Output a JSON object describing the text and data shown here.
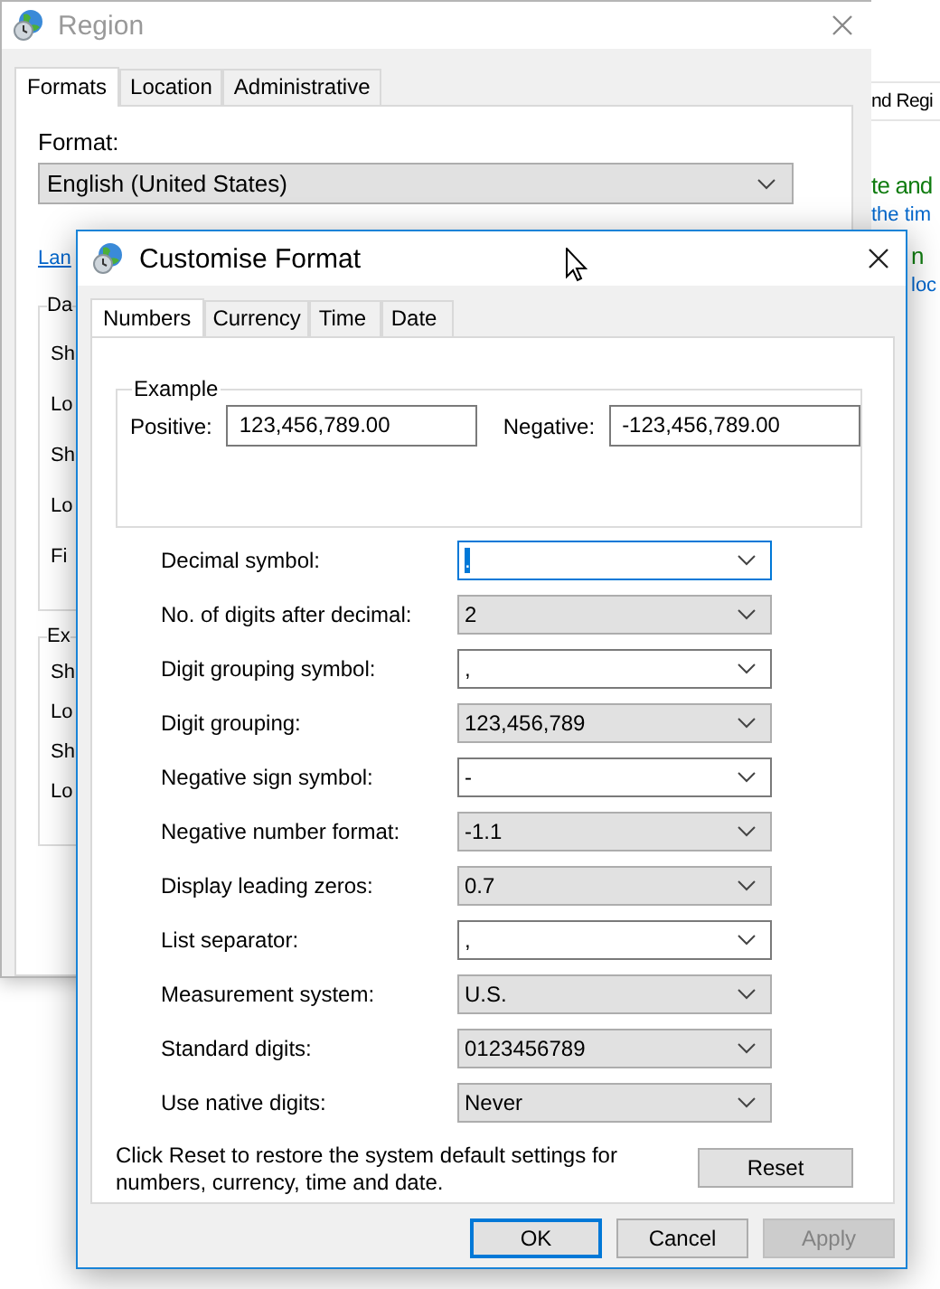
{
  "region_window": {
    "title": "Region",
    "tabs": [
      {
        "label": "Formats",
        "selected": true
      },
      {
        "label": "Location",
        "selected": false
      },
      {
        "label": "Administrative",
        "selected": false
      }
    ],
    "format_label": "Format:",
    "format_value": "English (United States)",
    "link": "Lan",
    "groups": [
      {
        "title": "Da",
        "rows": [
          "Sh",
          "Lo",
          "Sh",
          "Lo",
          "Fi"
        ]
      },
      {
        "title": "Ex",
        "rows": [
          "Sh",
          "Lo",
          "Sh",
          "Lo"
        ]
      }
    ]
  },
  "background_window": {
    "texts": [
      {
        "text": "nd Regi",
        "kind": "header"
      },
      {
        "text": "te and",
        "kind": "heading"
      },
      {
        "text": "the tim",
        "kind": "link"
      },
      {
        "text": "n",
        "kind": "heading"
      },
      {
        "text": "loc",
        "kind": "link"
      }
    ]
  },
  "dialog": {
    "title": "Customise Format",
    "tabs": [
      {
        "label": "Numbers",
        "selected": true
      },
      {
        "label": "Currency",
        "selected": false
      },
      {
        "label": "Time",
        "selected": false
      },
      {
        "label": "Date",
        "selected": false
      }
    ],
    "example": {
      "title": "Example",
      "positive_label": "Positive:",
      "positive_value": "123,456,789.00",
      "negative_label": "Negative:",
      "negative_value": "-123,456,789.00"
    },
    "settings": [
      {
        "label": "Decimal symbol:",
        "value": ".",
        "kind": "editable",
        "focused": true
      },
      {
        "label": "No. of digits after decimal:",
        "value": "2",
        "kind": "list",
        "focused": false
      },
      {
        "label": "Digit grouping symbol:",
        "value": ",",
        "kind": "editable",
        "focused": false
      },
      {
        "label": "Digit grouping:",
        "value": "123,456,789",
        "kind": "list",
        "focused": false
      },
      {
        "label": "Negative sign symbol:",
        "value": "-",
        "kind": "editable",
        "focused": false
      },
      {
        "label": "Negative number format:",
        "value": "-1.1",
        "kind": "list",
        "focused": false
      },
      {
        "label": "Display leading zeros:",
        "value": "0.7",
        "kind": "list",
        "focused": false
      },
      {
        "label": "List separator:",
        "value": ",",
        "kind": "editable",
        "focused": false
      },
      {
        "label": "Measurement system:",
        "value": "U.S.",
        "kind": "list",
        "focused": false
      },
      {
        "label": "Standard digits:",
        "value": "0123456789",
        "kind": "list",
        "focused": false
      },
      {
        "label": "Use native digits:",
        "value": "Never",
        "kind": "list",
        "focused": false
      }
    ],
    "note": "Click Reset to restore the system default settings for numbers, currency, time and date.",
    "reset": {
      "label": "Reset"
    },
    "buttons": [
      {
        "label": "OK",
        "default": true,
        "disabled": false
      },
      {
        "label": "Cancel",
        "default": false,
        "disabled": false
      },
      {
        "label": "Apply",
        "default": false,
        "disabled": true
      }
    ]
  }
}
